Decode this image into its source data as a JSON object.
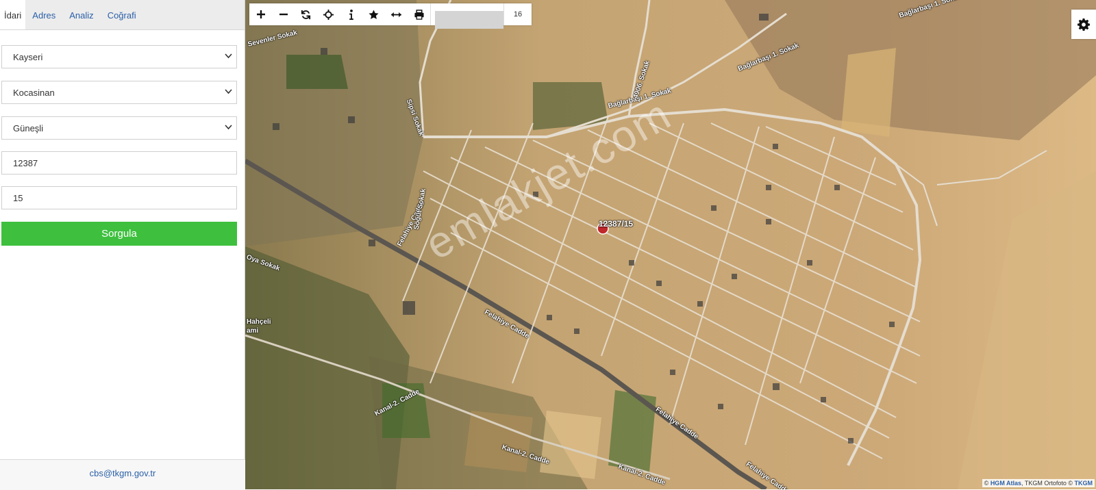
{
  "tabs": [
    {
      "label": "İdari",
      "active": true
    },
    {
      "label": "Adres",
      "active": false
    },
    {
      "label": "Analiz",
      "active": false
    },
    {
      "label": "Coğrafi",
      "active": false
    }
  ],
  "form": {
    "province": "Kayseri",
    "district": "Kocasinan",
    "neighborhood": "Güneşli",
    "block_no": "12387",
    "parcel_no": "15",
    "query_button": "Sorgula"
  },
  "footer": {
    "email": "cbs@tkgm.gov.tr"
  },
  "toolbar": {
    "icons": [
      "zoom-in-icon",
      "zoom-out-icon",
      "refresh-icon",
      "locate-icon",
      "info-icon",
      "favorite-icon",
      "measure-icon",
      "print-icon"
    ],
    "zoom_level": "16"
  },
  "map": {
    "parcel_label": "12387/15",
    "watermark": "emlakjet.com",
    "streets": [
      "Bağlarbaşı 1. Sokak",
      "Bağlarbaşı 1. Sokak",
      "Bağlarbaşı 1. Sokak",
      "4906. Sokak",
      "Sevenler Sokak",
      "Sipsi Sokak",
      "Felahiye Cadde",
      "Felahiye Cadde",
      "Felahiye Cadde",
      "Felahiye Cadde",
      "Kanal-2. Cadde",
      "Kanal-2. Cadde",
      "Kanal-2. Cadde",
      "Oya Sokak",
      "Söğüt Sokak",
      "Hahçeli",
      "ami"
    ],
    "attribution": {
      "prefix": "©",
      "hgm": "HGM Atlas",
      "tkgm_ortofoto": "TKGM Ortofoto ©",
      "tkgm": "TKGM"
    }
  },
  "colors": {
    "tab_link": "#2a5fa8",
    "query_button": "#3ec03e",
    "terrain": "#c9a774",
    "parcel_marker": "#c0282c"
  }
}
